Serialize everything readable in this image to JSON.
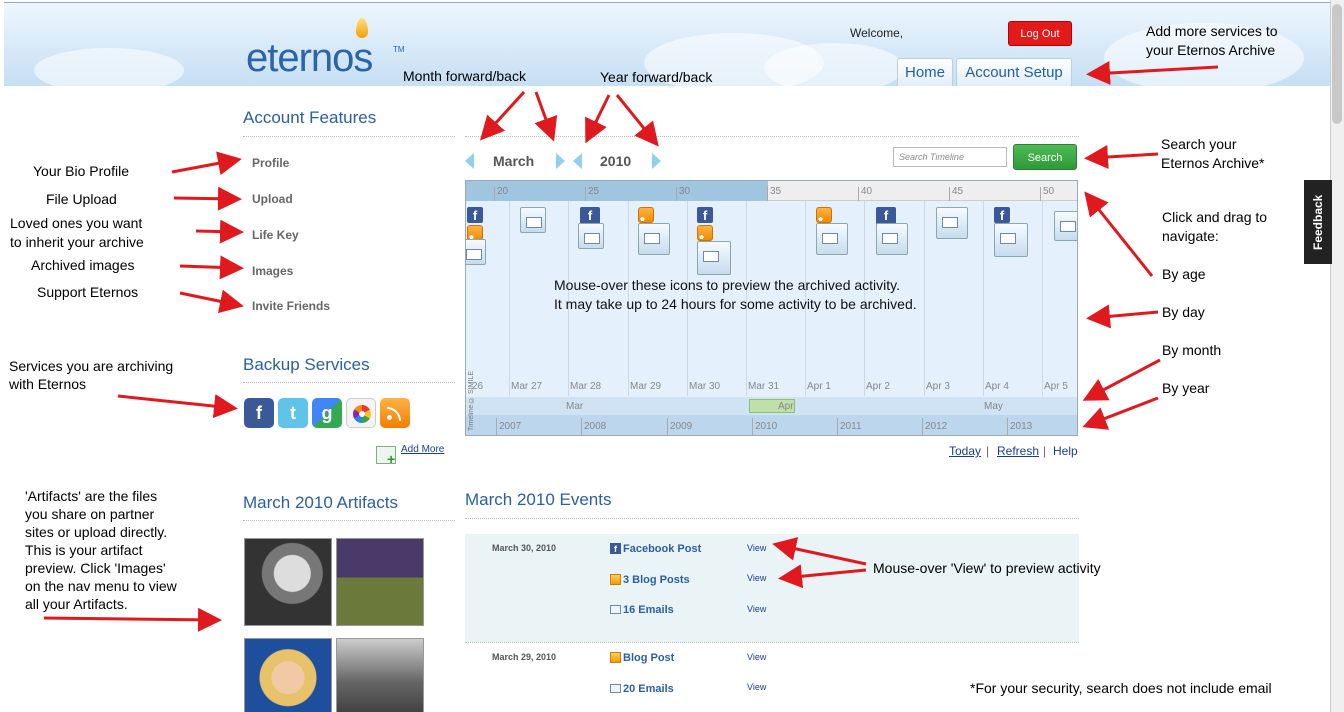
{
  "header": {
    "logo": "eternos",
    "logo_tm": "TM",
    "welcome": "Welcome,",
    "logout": "Log Out",
    "tabs": [
      "Home",
      "Account Setup"
    ],
    "feedback": "Feedback"
  },
  "sidebar": {
    "features_title": "Account Features",
    "nav": [
      "Profile",
      "Upload",
      "Life Key",
      "Images",
      "Invite Friends"
    ],
    "backup_title": "Backup Services",
    "services": [
      "facebook-icon",
      "twitter-icon",
      "google-icon",
      "picasa-icon",
      "rss-icon"
    ],
    "add_more": "Add More",
    "artifacts_title": "March 2010 Artifacts"
  },
  "timeline": {
    "month": "March",
    "year": "2010",
    "search_placeholder": "Search Timeline",
    "search_button": "Search",
    "ages": [
      "20",
      "25",
      "30",
      "35",
      "40",
      "45",
      "50"
    ],
    "days": [
      "26",
      "Mar 27",
      "Mar 28",
      "Mar 29",
      "Mar 30",
      "Mar 31",
      "Apr 1",
      "Apr 2",
      "Apr 3",
      "Apr 4",
      "Apr 5"
    ],
    "months": [
      "Mar",
      "Apr",
      "May"
    ],
    "years": [
      "2007",
      "2008",
      "2009",
      "2010",
      "2011",
      "2012",
      "2013"
    ],
    "credit": "Timeline © SIMILE",
    "caption_line1": "Mouse-over these icons to preview the archived activity.",
    "caption_line2": "It may take up to 24 hours for some activity to be archived.",
    "links": {
      "today": "Today",
      "refresh": "Refresh",
      "help": "Help"
    }
  },
  "events": {
    "title": "March 2010 Events",
    "groups": [
      {
        "date": "March 30, 2010",
        "items": [
          {
            "icon": "facebook-icon",
            "label": "Facebook Post",
            "view": "View"
          },
          {
            "icon": "blog-icon",
            "label": "3 Blog Posts",
            "view": "View"
          },
          {
            "icon": "email-icon",
            "label": "16 Emails",
            "view": "View"
          }
        ]
      },
      {
        "date": "March 29, 2010",
        "items": [
          {
            "icon": "blog-icon",
            "label": "Blog Post",
            "view": "View"
          },
          {
            "icon": "email-icon",
            "label": "20 Emails",
            "view": "View"
          }
        ]
      }
    ]
  },
  "annotations": {
    "month_nav": "Month forward/back",
    "year_nav": "Year forward/back",
    "add_services": [
      "Add more services to",
      "your Eternos Archive"
    ],
    "search_archive": [
      "Search your",
      "Eternos Archive*"
    ],
    "click_drag": [
      "Click and drag to",
      "navigate:"
    ],
    "by_age": "By age",
    "by_day": "By day",
    "by_month": "By month",
    "by_year": "By year",
    "bio_profile": "Your Bio Profile",
    "file_upload": "File Upload",
    "loved_ones": [
      "Loved ones you want",
      "to inherit your archive"
    ],
    "archived_images": "Archived images",
    "support": "Support Eternos",
    "services_archiving": [
      "Services you are archiving",
      "with Eternos"
    ],
    "artifacts_note": [
      "'Artifacts' are the files",
      "you share on partner",
      "sites or upload directly.",
      "This is your artifact",
      "preview. Click 'Images'",
      "on the nav menu to view",
      "all your Artifacts."
    ],
    "mouse_view": "Mouse-over 'View' to preview activity",
    "security": "*For your security, search does not include email"
  },
  "colors": {
    "accent_blue": "#2b5fa3",
    "logout_red": "#e41a1a",
    "search_green": "#2e9a37",
    "annotation_arrow": "#e0191e"
  }
}
